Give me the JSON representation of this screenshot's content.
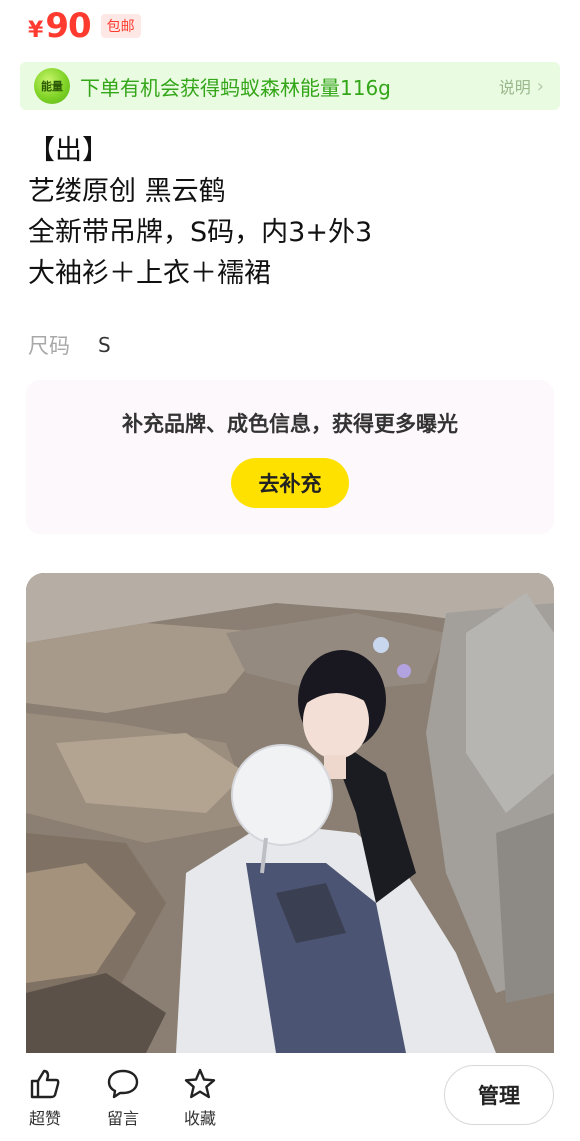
{
  "price": {
    "currency": "¥",
    "value": "90",
    "shipping_badge": "包邮"
  },
  "energy": {
    "icon_label": "能量",
    "text": "下单有机会获得蚂蚁森林能量116g",
    "explain": "说明",
    "accent": "#34a61a"
  },
  "description": {
    "lines": [
      "【出】",
      "艺缕原创 黑云鹤",
      "全新带吊牌，S码，内3+外3",
      "大袖衫＋上衣＋襦裙"
    ]
  },
  "attributes": {
    "size_label": "尺码",
    "size_value": "S"
  },
  "supplement": {
    "text": "补充品牌、成色信息，获得更多曝光",
    "button": "去补充",
    "button_color": "#ffe100"
  },
  "bottom_bar": {
    "like_label": "超赞",
    "comment_label": "留言",
    "favorite_label": "收藏",
    "manage_label": "管理"
  },
  "icons": {
    "like": "thumbs-up-icon",
    "comment": "comment-bubble-icon",
    "favorite": "star-icon",
    "energy": "energy-ball-icon",
    "explain": "chevron-right-icon"
  }
}
